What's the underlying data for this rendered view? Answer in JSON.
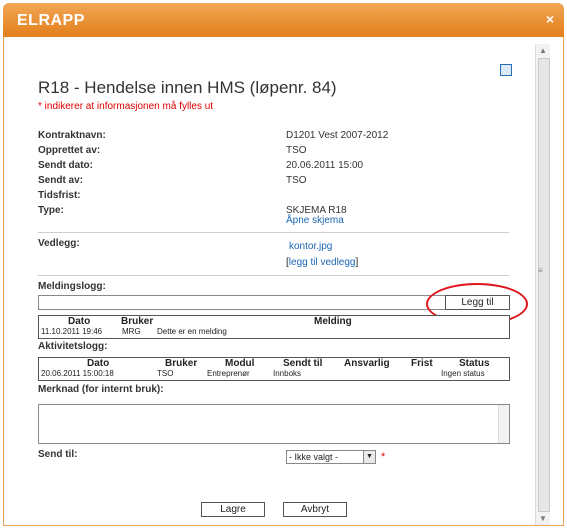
{
  "window": {
    "title": "ELRAPP",
    "close_glyph": "×"
  },
  "form": {
    "heading": "R18 - Hendelse innen HMS (løpenr. 84)",
    "required_note": "* indikerer at informasjonen må fylles ut",
    "fields": {
      "kontraktnavn_label": "Kontraktnavn:",
      "kontraktnavn_value": "D1201 Vest 2007-2012",
      "opprettet_label": "Opprettet av:",
      "opprettet_value": "TSO",
      "sendt_dato_label": "Sendt dato:",
      "sendt_dato_value": "20.06.2011 15:00",
      "sendt_av_label": "Sendt av:",
      "sendt_av_value": "TSO",
      "tidsfrist_label": "Tidsfrist:",
      "type_label": "Type:",
      "type_value": "SKJEMA R18",
      "type_link": "Åpne skjema"
    },
    "vedlegg": {
      "label": "Vedlegg:",
      "file": "kontor.jpg",
      "add_link": "legg til vedlegg"
    },
    "meldingslogg": {
      "label": "Meldingslogg:",
      "add_button": "Legg til",
      "headers": [
        "Dato",
        "Bruker",
        "Melding"
      ],
      "rows": [
        [
          "11.10.2011 19:46",
          "MRG",
          "Dette er en melding"
        ]
      ]
    },
    "aktivitetslogg": {
      "label": "Aktivitetslogg:",
      "headers": [
        "Dato",
        "Bruker",
        "Modul",
        "Sendt til",
        "Ansvarlig",
        "Frist",
        "Status"
      ],
      "rows": [
        [
          "20.06.2011 15:00:18",
          "TSO",
          "Entreprenør",
          "Innboks",
          "",
          "",
          "Ingen status"
        ]
      ]
    },
    "merknad_label": "Merknad (for internt bruk):",
    "send_til": {
      "label": "Send til:",
      "selected": "- Ikke valgt -",
      "required_star": "*"
    },
    "buttons": {
      "save": "Lagre",
      "cancel": "Avbryt"
    }
  },
  "colors": {
    "titlebar": "#e8922f",
    "required": "#e00000",
    "link": "#1b66b3",
    "highlight_circle": "#e0141c"
  }
}
